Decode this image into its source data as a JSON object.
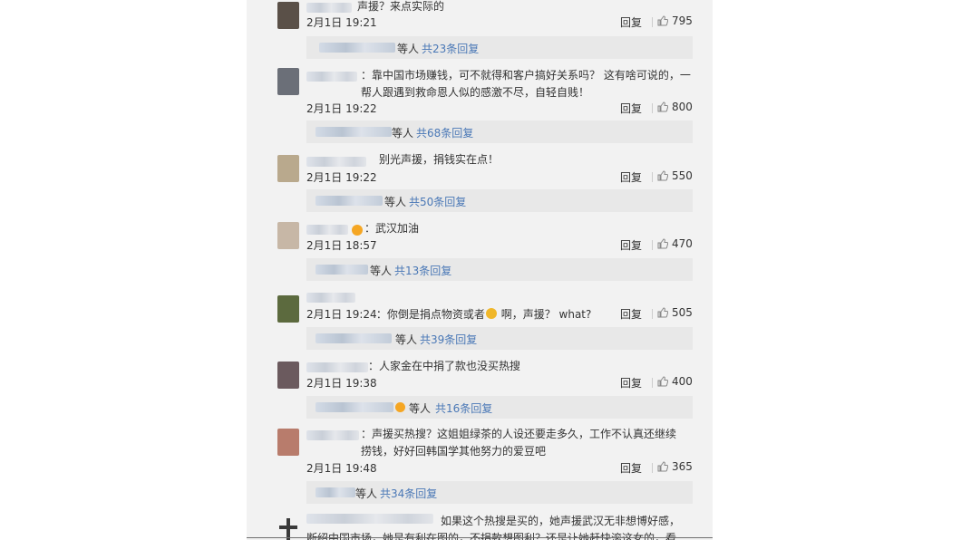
{
  "ui": {
    "reply_label": "回复",
    "who_suffix": "等人"
  },
  "comments": [
    {
      "text": "声援？来点实际的",
      "date": "2月1日 19:21",
      "likes": "795",
      "replies": "共23条回复"
    },
    {
      "text": "：靠中国市场赚钱，可不就得和客户搞好关系吗？ 这有啥可说的，一\n帮人跟遇到救命恩人似的感激不尽，自轻自贱！",
      "date": "2月1日 19:22",
      "likes": "800",
      "replies": "共68条回复"
    },
    {
      "text": "别光声援，捐钱实在点！",
      "date": "2月1日 19:22",
      "likes": "550",
      "replies": "共50条回复"
    },
    {
      "text": "：武汉加油",
      "date": "2月1日 18:57",
      "likes": "470",
      "replies": "共13条回复"
    },
    {
      "text_before": "：你倒是捐点物资或者",
      "text_after": " 啊，声援？ what?",
      "date": "2月1日 19:24",
      "likes": "505",
      "replies": "共39条回复"
    },
    {
      "text": "：人家金在中捐了款也没买热搜",
      "date": "2月1日 19:38",
      "likes": "400",
      "replies": "共16条回复"
    },
    {
      "text": "：声援买热搜？这姐姐绿茶的人设还要走多久，工作不认真还继续\n捞钱，好好回韩国学其他努力的爱豆吧",
      "date": "2月1日 19:48",
      "likes": "365",
      "replies": "共34条回复"
    },
    {
      "text": "如果这个热搜是买的，她声援武汉无非想博好感，\n断绍中国市场，她是有利在图的，不捐款想图利？还是让她赶快滚这女的，看"
    }
  ]
}
